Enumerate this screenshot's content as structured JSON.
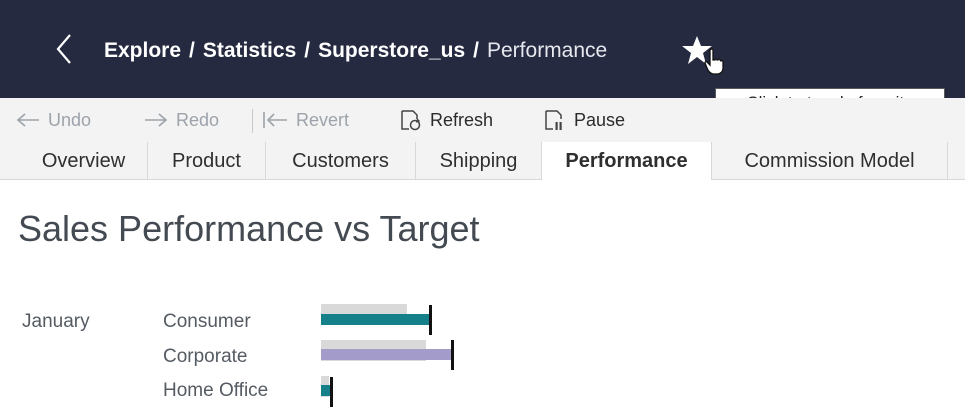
{
  "header": {
    "breadcrumbs": [
      "Explore",
      "Statistics",
      "Superstore_us"
    ],
    "separator": "/",
    "current": "Performance"
  },
  "tooltip": {
    "text": "Click to toggle favorite"
  },
  "toolbar": {
    "undo_label": "Undo",
    "redo_label": "Redo",
    "revert_label": "Revert",
    "refresh_label": "Refresh",
    "pause_label": "Pause"
  },
  "tabs": [
    {
      "label": "Overview",
      "active": false
    },
    {
      "label": "Product",
      "active": false
    },
    {
      "label": "Customers",
      "active": false
    },
    {
      "label": "Shipping",
      "active": false
    },
    {
      "label": "Performance",
      "active": true
    },
    {
      "label": "Commission Model",
      "active": false
    }
  ],
  "dashboard": {
    "title": "Sales Performance vs Target",
    "month": "January",
    "segments": [
      "Consumer",
      "Corporate",
      "Home Office"
    ]
  },
  "colors": {
    "header_bg": "#252a40",
    "consumer": "#157f8a",
    "corporate": "#a39ccb",
    "home_office": "#157f8a",
    "reference_band": "#d9d9d9"
  },
  "icons": {
    "back": "chevron-left-icon",
    "favorite": "star-icon",
    "cursor": "hand-pointer-icon",
    "undo": "arrow-left-icon",
    "redo": "arrow-right-icon",
    "revert": "revert-icon",
    "refresh": "refresh-icon",
    "pause": "pause-icon"
  }
}
